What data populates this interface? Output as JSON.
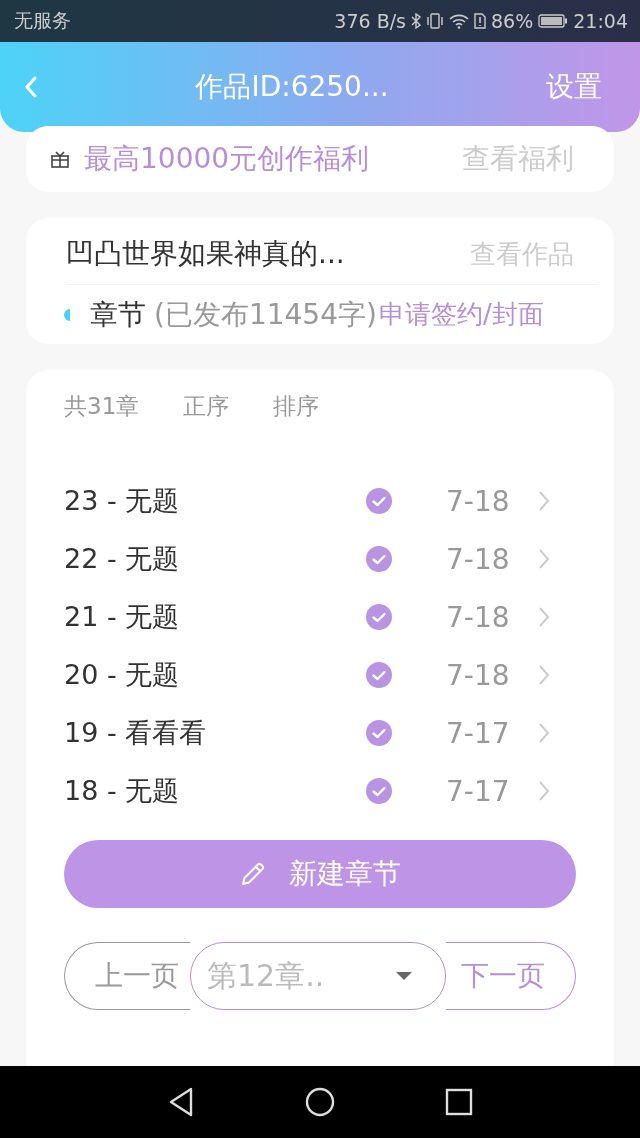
{
  "status_bar": {
    "carrier": "无服务",
    "speed": "376 B/s",
    "battery": "86%",
    "time": "21:04"
  },
  "header": {
    "title": "作品ID:6250...",
    "action": "设置"
  },
  "promo": {
    "text": "最高10000元创作福利",
    "link": "查看福利"
  },
  "work": {
    "title": "凹凸世界如果神真的...",
    "link": "查看作品",
    "section": "章节",
    "count": "(已发布11454字)",
    "apply": "申请签约/封面"
  },
  "list_header": {
    "count": "共31章",
    "sort_options": [
      "正序",
      "排序"
    ]
  },
  "chapters": [
    {
      "title": "23 - 无题",
      "published": true,
      "date": "7-18"
    },
    {
      "title": "22 - 无题",
      "published": true,
      "date": "7-18"
    },
    {
      "title": "21 - 无题",
      "published": true,
      "date": "7-18"
    },
    {
      "title": "20 - 无题",
      "published": true,
      "date": "7-18"
    },
    {
      "title": "19 - 看看看",
      "published": true,
      "date": "7-17"
    },
    {
      "title": "18 - 无题",
      "published": true,
      "date": "7-17"
    }
  ],
  "new_chapter_button": "新建章节",
  "pager": {
    "prev": "上一页",
    "select": "第12章..",
    "next": "下一页"
  }
}
